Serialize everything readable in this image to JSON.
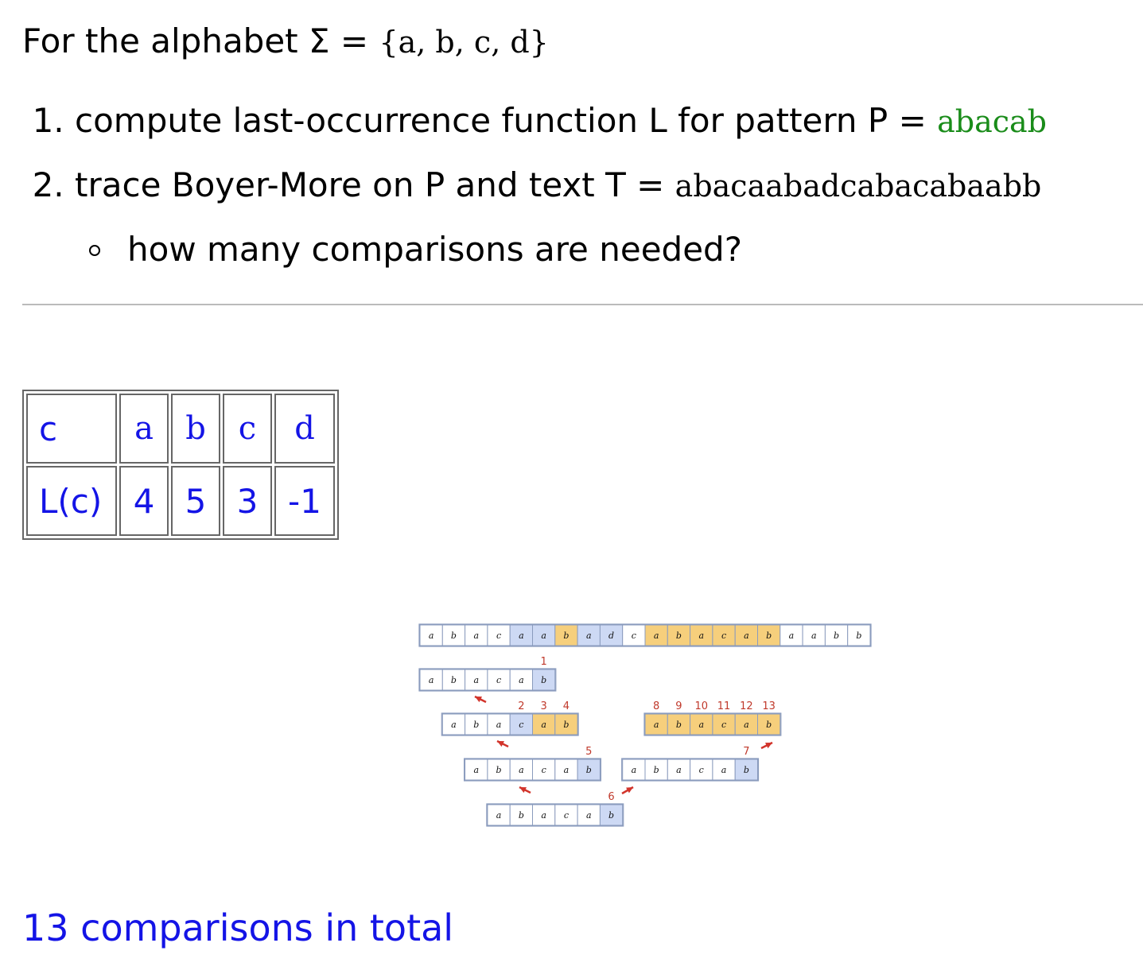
{
  "intro": {
    "prefix": "For the alphabet Σ = ",
    "alphabet": "{a, b, c, d}"
  },
  "tasks": [
    {
      "text": "compute last-occurrence function L for pattern P = ",
      "value": "abacab"
    },
    {
      "text": "trace Boyer-More on P and text T = ",
      "value": "abacaabadcabacabaabb"
    }
  ],
  "subtask": "how many comparisons are needed?",
  "last_occurrence_table": {
    "header_label": "c",
    "row_label": "L(c)",
    "symbols": [
      "a",
      "b",
      "c",
      "d"
    ],
    "values": [
      "4",
      "5",
      "3",
      "-1"
    ]
  },
  "trace": {
    "text": [
      "a",
      "b",
      "a",
      "c",
      "a",
      "a",
      "b",
      "a",
      "d",
      "c",
      "a",
      "b",
      "a",
      "c",
      "a",
      "b",
      "a",
      "a",
      "b",
      "b"
    ],
    "text_highlight": [
      "none",
      "none",
      "none",
      "none",
      "blue",
      "blue",
      "orange",
      "blue",
      "blue",
      "none",
      "orange",
      "orange",
      "orange",
      "orange",
      "orange",
      "orange",
      "none",
      "none",
      "none",
      "none"
    ],
    "pattern": [
      "a",
      "b",
      "a",
      "c",
      "a",
      "b"
    ],
    "alignments": [
      {
        "shift": 0,
        "highlight": [
          "none",
          "none",
          "none",
          "none",
          "none",
          "blue"
        ],
        "counts": [
          "1"
        ]
      },
      {
        "shift": 1,
        "highlight": [
          "none",
          "none",
          "none",
          "blue",
          "orange",
          "orange"
        ],
        "counts": [
          "4",
          "3",
          "2"
        ]
      },
      {
        "shift": 2,
        "highlight": [
          "none",
          "none",
          "none",
          "none",
          "none",
          "blue"
        ],
        "counts": [
          "5"
        ]
      },
      {
        "shift": 3,
        "highlight": [
          "none",
          "none",
          "none",
          "none",
          "none",
          "blue"
        ],
        "counts": [
          "6"
        ]
      },
      {
        "shift": 10,
        "highlight": [
          "orange",
          "orange",
          "orange",
          "orange",
          "orange",
          "orange"
        ],
        "counts": [
          "13",
          "12",
          "11",
          "10",
          "9",
          "8"
        ]
      },
      {
        "shift": 9,
        "highlight": [
          "none",
          "none",
          "none",
          "none",
          "none",
          "blue"
        ],
        "counts": [
          "7"
        ]
      }
    ],
    "colors": {
      "blue": "#cdd9f4",
      "orange": "#f6cf7c",
      "border": "#8a9bbd",
      "arrow": "#d2342b"
    }
  },
  "result": "13 comparisons in total"
}
